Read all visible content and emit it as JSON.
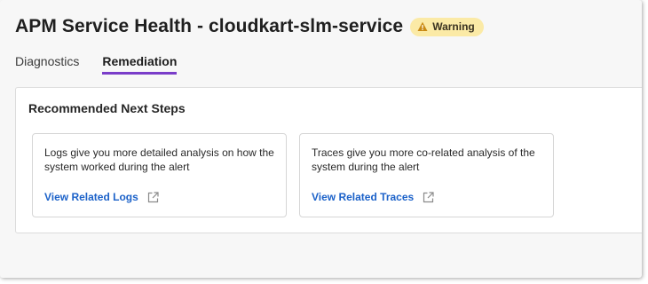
{
  "header": {
    "title": "APM Service Health - cloudkart-slm-service",
    "status_badge": {
      "label": "Warning",
      "icon": "warning-triangle-icon",
      "color": "#fbeaa6"
    }
  },
  "tabs": [
    {
      "label": "Diagnostics",
      "active": false
    },
    {
      "label": "Remediation",
      "active": true
    }
  ],
  "accent_color": "#7a3dc9",
  "link_color": "#1c62c9",
  "panel": {
    "title": "Recommended Next Steps",
    "cards": [
      {
        "description": "Logs give you more detailed analysis on how the system worked during the alert",
        "link_label": "View Related Logs",
        "link_icon": "external-link-icon"
      },
      {
        "description": "Traces give you more co-related analysis of the system during the alert",
        "link_label": "View Related Traces",
        "link_icon": "external-link-icon"
      }
    ]
  }
}
